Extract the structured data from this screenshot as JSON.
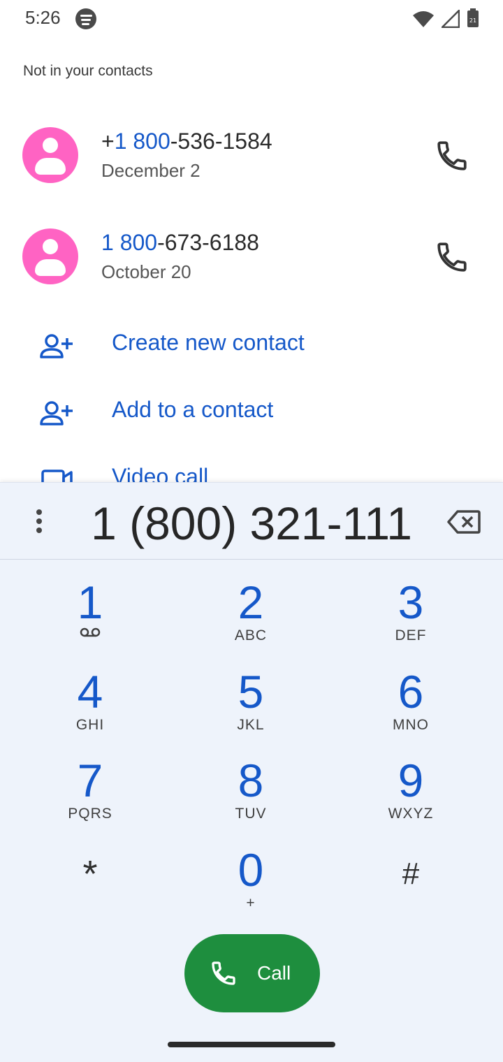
{
  "status_bar": {
    "time": "5:26",
    "icons": [
      "spotify-icon",
      "wifi-icon",
      "signal-icon",
      "battery-icon"
    ],
    "battery_level": "21"
  },
  "suggestions": {
    "header": "Not in your contacts",
    "contacts": [
      {
        "number_prefix": "+",
        "number_match": "1 800",
        "number_rest": "-536-1584",
        "date": "December 2"
      },
      {
        "number_prefix": "",
        "number_match": "1 800",
        "number_rest": "-673-6188",
        "date": "October 20"
      }
    ],
    "actions": [
      {
        "label": "Create new contact",
        "icon": "person-add-icon"
      },
      {
        "label": "Add to a contact",
        "icon": "person-add-icon"
      },
      {
        "label": "Video call",
        "icon": "videocam-icon"
      }
    ]
  },
  "dialpad": {
    "entered_number": "1 (800) 321-111",
    "keys": [
      {
        "digit": "1",
        "letters": ""
      },
      {
        "digit": "2",
        "letters": "ABC"
      },
      {
        "digit": "3",
        "letters": "DEF"
      },
      {
        "digit": "4",
        "letters": "GHI"
      },
      {
        "digit": "5",
        "letters": "JKL"
      },
      {
        "digit": "6",
        "letters": "MNO"
      },
      {
        "digit": "7",
        "letters": "PQRS"
      },
      {
        "digit": "8",
        "letters": "TUV"
      },
      {
        "digit": "9",
        "letters": "WXYZ"
      },
      {
        "digit": "*",
        "letters": ""
      },
      {
        "digit": "0",
        "letters": "+"
      },
      {
        "digit": "#",
        "letters": ""
      }
    ],
    "call_label": "Call"
  },
  "colors": {
    "accent_blue": "#1558c9",
    "avatar_pink": "#ff63c3",
    "call_green": "#1e8e3e",
    "dialpad_bg": "#eef3fb"
  }
}
